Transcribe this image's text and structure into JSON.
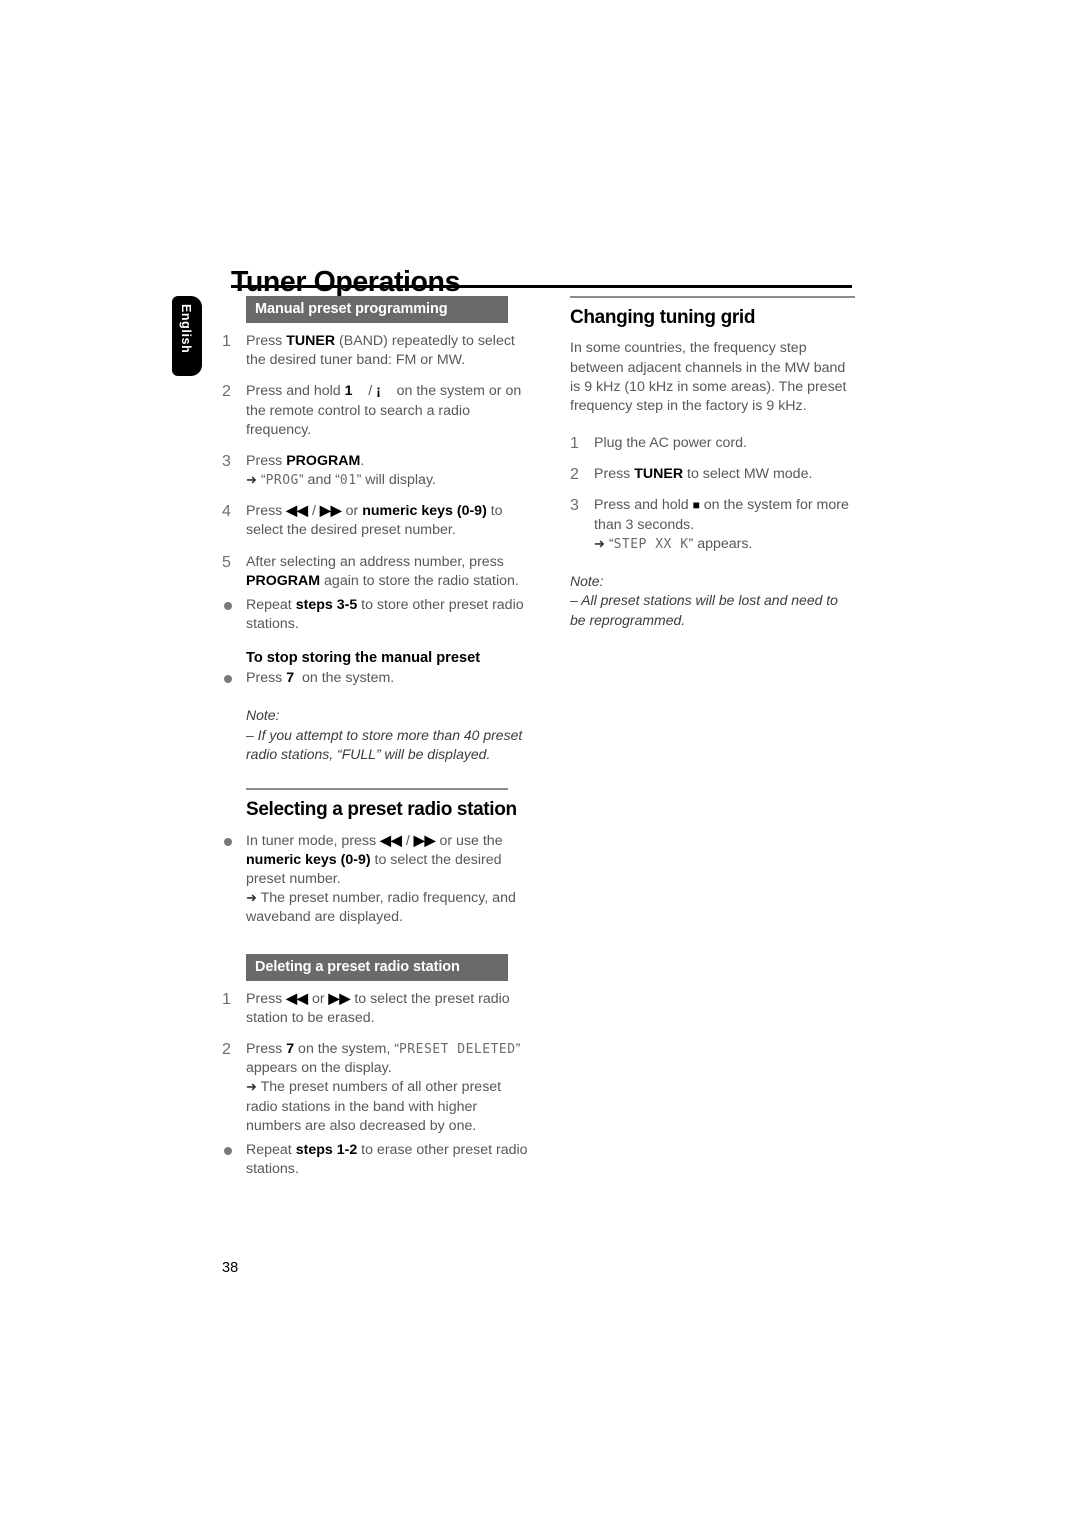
{
  "document": {
    "title": "Tuner Operations",
    "language_tab": "English",
    "page_number": "38"
  },
  "left_column": {
    "manual_preset": {
      "bar_heading": "Manual preset programming",
      "steps": [
        {
          "num": "1",
          "html": "Press <b>TUNER</b> (BAND) repeatedly to select the desired tuner band: FM or MW."
        },
        {
          "num": "2",
          "html": "Press and hold <b>1</b>&nbsp;&nbsp;&nbsp;&nbsp;/ <span class=\"glyph\">¡</span>&nbsp;&nbsp;&nbsp; on the system or on the remote control to search a radio frequency."
        },
        {
          "num": "3",
          "html": "Press <b>PROGRAM</b>.<span class=\"arrow-line\"><span class=\"arrow\">➜</span> &ldquo;<span class=\"lcd\">PROG</span>&rdquo; and &ldquo;<span class=\"lcd\">01</span>&rdquo; will display.</span>"
        },
        {
          "num": "4",
          "html": "Press <span class=\"glyph\">◀◀</span> / <span class=\"glyph\">▶▶</span> or <b>numeric keys (0-9)</b> to select the desired preset number."
        },
        {
          "num": "5",
          "html": "After selecting an address number, press <b>PROGRAM</b> again to store the radio station."
        },
        {
          "num": "•",
          "html": "Repeat <b>steps 3-5</b> to store other preset radio stations."
        }
      ],
      "sub_heading": "To stop storing the manual preset",
      "stop_bullet_html": "Press <b>7</b>&nbsp; on the system.",
      "note_label": "Note:",
      "note_body": "–  If you attempt to store more than 40 preset radio stations, &ldquo;FULL&rdquo; will be displayed."
    },
    "selecting_preset": {
      "heading": "Selecting a preset radio station",
      "bullet_html": "In tuner mode, press <span class=\"glyph\">◀◀</span> / <span class=\"glyph\">▶▶</span> or use the <b>numeric keys (0-9)</b> to select the desired preset number.<span class=\"arrow-line\"><span class=\"arrow\">➜</span> The preset number, radio frequency, and waveband are displayed.</span>"
    },
    "deleting_preset": {
      "bar_heading": "Deleting a preset radio station",
      "steps": [
        {
          "num": "1",
          "html": "Press <span class=\"glyph\">◀◀</span> or <span class=\"glyph\">▶▶</span> to select the preset radio station to be erased."
        },
        {
          "num": "2",
          "html": "Press <b>7</b> on the system, &ldquo;<span class=\"lcd\">PRESET DELETED</span>&rdquo; appears on the display.<span class=\"arrow-line\"><span class=\"arrow\">➜</span> The preset numbers of all other preset radio stations in the band with higher numbers are also decreased by one.</span>"
        },
        {
          "num": "•",
          "html": "Repeat <b>steps 1-2</b> to erase other preset radio stations."
        }
      ]
    }
  },
  "right_column": {
    "changing_grid": {
      "heading": "Changing tuning grid",
      "intro": "In some countries, the frequency step between adjacent channels in the MW band is 9 kHz (10 kHz in some areas). The preset frequency step in the factory is 9 kHz.",
      "steps": [
        {
          "num": "1",
          "html": "Plug the AC power cord."
        },
        {
          "num": "2",
          "html": "Press <b>TUNER</b> to select MW mode."
        },
        {
          "num": "3",
          "html": "Press and hold <span class=\"glyph-sq\">■</span> on the system for more than 3 seconds.<span class=\"arrow-line\"><span class=\"arrow\">➜</span> &ldquo;<span class=\"lcd\">STEP  XX K</span>&rdquo; appears.</span>"
        }
      ],
      "note_label": "Note:",
      "note_body": "–  All preset stations will be lost and need to be reprogrammed."
    }
  }
}
